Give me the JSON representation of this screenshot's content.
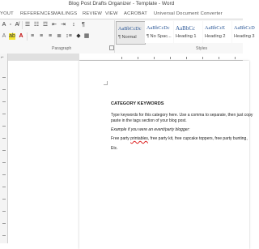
{
  "window": {
    "title": "Blog Post Drafts Organizer - Template - Word"
  },
  "tabs": [
    "YOUT",
    "REFERENCES",
    "MAILINGS",
    "REVIEW",
    "VIEW",
    "ACROBAT",
    "Universal Document Converter"
  ],
  "ribbon": {
    "paragraph_label": "Paragraph",
    "styles_label": "Styles",
    "styles": [
      {
        "preview": "AaBbCcDc",
        "name": "¶ Normal"
      },
      {
        "preview": "AaBbCcDc",
        "name": "¶ No Spac..."
      },
      {
        "preview": "AaBbCc",
        "name": "Heading 1"
      },
      {
        "preview": "AaBbCcE",
        "name": "Heading 2"
      },
      {
        "preview": "AaBbCcD",
        "name": "Heading 3"
      }
    ]
  },
  "document": {
    "heading": "CATEGORY KEYWORDS",
    "line1": "Type keywords for this category here. Use a comma to separate, then just copy",
    "line2": "paste in the tags section of your blog post.",
    "example_label": "Example if you were an event/party blogger:",
    "example_prefix": "Free party ",
    "example_misspelled": "printables",
    "example_suffix": ", free party kit, free cupcake toppers, free party bunting,",
    "etc": "Etc."
  },
  "colors": {
    "highlight": "#f3e532",
    "font_red": "#c00000",
    "style_blue": "#2b5797"
  }
}
